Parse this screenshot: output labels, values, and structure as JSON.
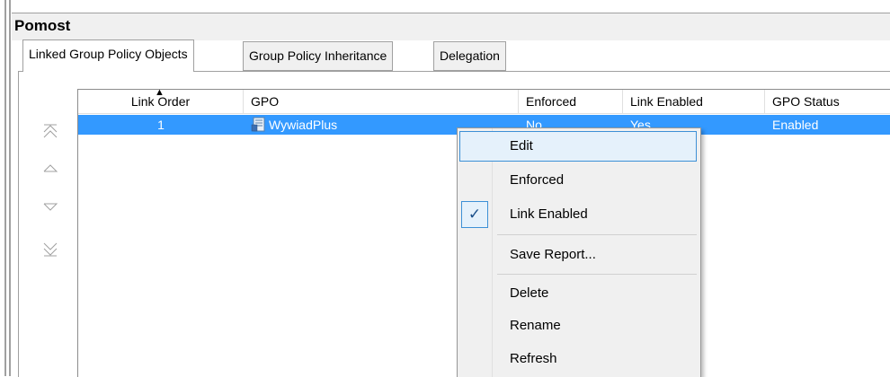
{
  "title": "Pomost",
  "tabs": [
    {
      "label": "Linked Group Policy Objects",
      "active": true
    },
    {
      "label": "Group Policy Inheritance",
      "active": false
    },
    {
      "label": "Delegation",
      "active": false
    }
  ],
  "side_buttons": [
    {
      "icon": "move-to-top-icon"
    },
    {
      "icon": "move-up-icon"
    },
    {
      "icon": "move-down-icon"
    },
    {
      "icon": "move-to-bottom-icon"
    }
  ],
  "grid": {
    "columns": [
      "Link Order",
      "GPO",
      "Enforced",
      "Link Enabled",
      "GPO Status"
    ],
    "rows": [
      {
        "link_order": "1",
        "gpo": "WywiadPlus",
        "enforced": "No",
        "link_enabled": "Yes",
        "gpo_status": "Enabled",
        "selected": true
      }
    ]
  },
  "context_menu": {
    "items": [
      {
        "label": "Edit",
        "checked": false
      },
      {
        "label": "Enforced",
        "checked": false
      },
      {
        "label": "Link Enabled",
        "checked": true
      },
      {
        "label": "Save Report...",
        "checked": false
      },
      {
        "label": "Delete",
        "checked": false
      },
      {
        "label": "Rename",
        "checked": false
      },
      {
        "label": "Refresh",
        "checked": false
      }
    ]
  },
  "colors": {
    "selection": "#3399ff",
    "menu_hover": "#e5f1fb",
    "menu_hover_border": "#3d90d6"
  }
}
